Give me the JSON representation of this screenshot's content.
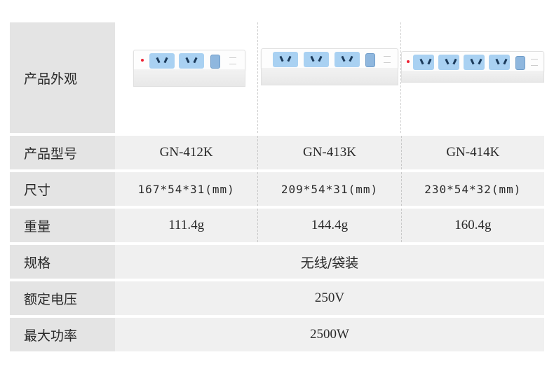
{
  "labels": {
    "appearance": "产品外观",
    "model": "产品型号",
    "size": "尺寸",
    "weight": "重量",
    "spec": "规格",
    "voltage": "额定电压",
    "power": "最大功率"
  },
  "products": [
    {
      "model": "GN-412K",
      "size": "167*54*31(mm)",
      "weight": "111.4g",
      "outlets": 2,
      "image_icon": "power-strip-2-outlet"
    },
    {
      "model": "GN-413K",
      "size": "209*54*31(mm)",
      "weight": "144.4g",
      "outlets": 3,
      "image_icon": "power-strip-3-outlet"
    },
    {
      "model": "GN-414K",
      "size": "230*54*32(mm)",
      "weight": "160.4g",
      "outlets": 4,
      "image_icon": "power-strip-4-outlet"
    }
  ],
  "shared": {
    "spec": "无线/袋装",
    "voltage": "250V",
    "power": "2500W"
  },
  "colors": {
    "label_bg": "#e4e4e4",
    "cell_bg": "#f0f0f0",
    "outlet_blue": "#a9d1f2",
    "text": "#2a2a2a"
  }
}
